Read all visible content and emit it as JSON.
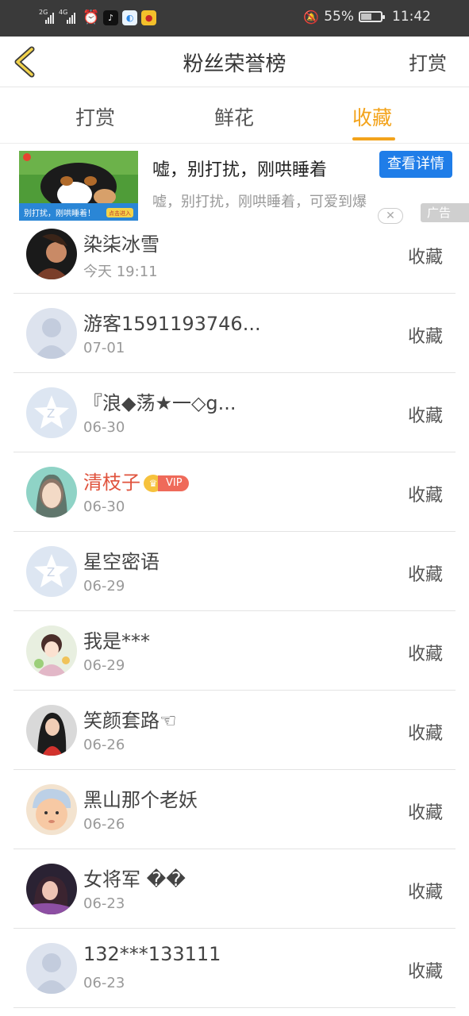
{
  "statusbar": {
    "signal1": "2G",
    "signal2": "4G",
    "battery": "55%",
    "battery_level": 0.55,
    "time": "11:42"
  },
  "header": {
    "title": "粉丝荣誉榜",
    "right_button": "打赏"
  },
  "tabs": [
    {
      "label": "打赏",
      "active": false
    },
    {
      "label": "鲜花",
      "active": false
    },
    {
      "label": "收藏",
      "active": true
    }
  ],
  "ad": {
    "title": "嘘，别打扰，刚哄睡着",
    "button": "查看详情",
    "description": "嘘，别打扰，刚哄睡着，可爱到爆",
    "image_caption": "别打扰，刚哄睡着！",
    "image_cta": "点击进入",
    "close": "✕",
    "tag": "广告"
  },
  "colors": {
    "accent": "#f3a31b",
    "vip_name": "#e0533d",
    "ad_button": "#1f7de8"
  },
  "fans": [
    {
      "name": "染柒冰雪",
      "date": "今天 19:11",
      "action": "收藏",
      "avatar": "photo-dark"
    },
    {
      "name": "游客1591193746...",
      "date": "07-01",
      "action": "收藏",
      "avatar": "default-person"
    },
    {
      "name": "『浪◆荡★一◇g...",
      "date": "06-30",
      "action": "收藏",
      "avatar": "default-z"
    },
    {
      "name": "清枝子",
      "date": "06-30",
      "action": "收藏",
      "avatar": "photo-teal",
      "vip": "VIP"
    },
    {
      "name": "星空密语",
      "date": "06-29",
      "action": "收藏",
      "avatar": "default-z"
    },
    {
      "name": "我是***",
      "date": "06-29",
      "action": "收藏",
      "avatar": "photo-anime"
    },
    {
      "name": "笑颜套路☜",
      "date": "06-26",
      "action": "收藏",
      "avatar": "photo-red"
    },
    {
      "name": "黑山那个老妖",
      "date": "06-26",
      "action": "收藏",
      "avatar": "photo-baby"
    },
    {
      "name": "女将军 ��",
      "date": "06-23",
      "action": "收藏",
      "avatar": "photo-purple"
    },
    {
      "name": "132***133111",
      "date": "06-23",
      "action": "收藏",
      "avatar": "default-person"
    }
  ]
}
